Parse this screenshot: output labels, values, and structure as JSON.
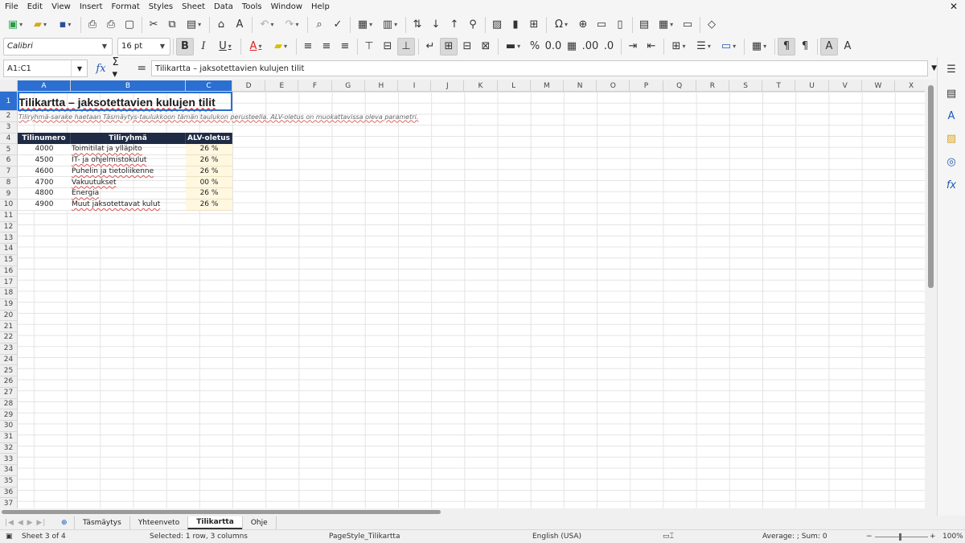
{
  "menu": [
    "File",
    "Edit",
    "View",
    "Insert",
    "Format",
    "Styles",
    "Sheet",
    "Data",
    "Tools",
    "Window",
    "Help"
  ],
  "toolbar": {
    "font_name": "Calibri",
    "font_size": "16 pt"
  },
  "formula_bar": {
    "name_box": "A1:C1",
    "formula": "Tilikartta – jaksotettavien kulujen tilit"
  },
  "columns": [
    "A",
    "B",
    "C",
    "D",
    "E",
    "F",
    "G",
    "H",
    "I",
    "J",
    "K",
    "L",
    "M",
    "N",
    "O",
    "P",
    "Q",
    "R",
    "S",
    "T",
    "U",
    "V",
    "W",
    "X"
  ],
  "rows": [
    "1",
    "2",
    "3",
    "4",
    "5",
    "6",
    "7",
    "8",
    "9",
    "10",
    "11",
    "12",
    "13",
    "14",
    "15",
    "16",
    "17",
    "18",
    "19",
    "20",
    "21",
    "22",
    "23",
    "24",
    "25",
    "26",
    "27",
    "28",
    "29",
    "30",
    "31",
    "32",
    "33",
    "34",
    "35",
    "36",
    "37"
  ],
  "sheet": {
    "title": "Tilikartta – jaksotettavien kulujen tilit",
    "subtitle": "Tiliryhmä-sarake haetaan Täsmäytys-taulukkoon tämän taulukon perusteella. ALV-oletus on muokattavissa oleva parametri.",
    "headers": [
      "Tilinumero",
      "Tiliryhmä",
      "ALV-oletus"
    ],
    "rows": [
      {
        "account": "4000",
        "group": "Toimitilat ja ylläpito",
        "vat": "26 %"
      },
      {
        "account": "4500",
        "group": "IT- ja ohjelmistokulut",
        "vat": "26 %"
      },
      {
        "account": "4600",
        "group": "Puhelin ja tietoliikenne",
        "vat": "26 %"
      },
      {
        "account": "4700",
        "group": "Vakuutukset",
        "vat": "00 %"
      },
      {
        "account": "4800",
        "group": "Energia",
        "vat": "26 %"
      },
      {
        "account": "4900",
        "group": "Muut jaksotettavat kulut",
        "vat": "26 %"
      }
    ]
  },
  "tabs": [
    "Täsmäytys",
    "Yhteenveto",
    "Tilikartta",
    "Ohje"
  ],
  "active_tab": "Tilikartta",
  "status": {
    "sheet": "Sheet 3 of 4",
    "selection": "Selected: 1 row, 3 columns",
    "page_style": "PageStyle_Tilikartta",
    "language": "English (USA)",
    "summary": "Average: ; Sum: 0",
    "zoom": "100%"
  }
}
